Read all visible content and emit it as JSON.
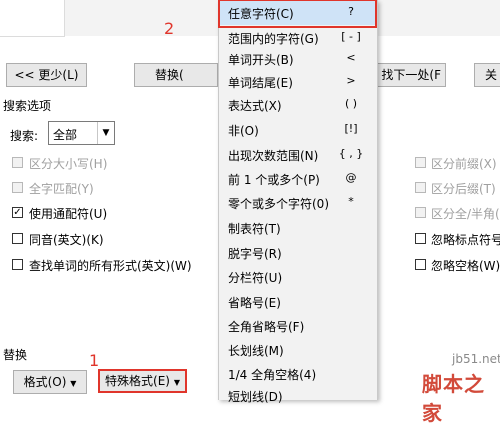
{
  "annotations": {
    "step1": "1",
    "step2": "2"
  },
  "buttons": {
    "less": "<< 更少(L)",
    "replace": "替换(",
    "find_next": "找下一处(F",
    "close": "关"
  },
  "search_options": {
    "title": "搜索选项",
    "search_label": "搜索:",
    "search_value": "全部",
    "left_options": [
      {
        "label": "区分大小写(H)",
        "checked": false,
        "disabled": true
      },
      {
        "label": "全字匹配(Y)",
        "checked": false,
        "disabled": true
      },
      {
        "label": "使用通配符(U)",
        "checked": true,
        "disabled": false
      },
      {
        "label": "同音(英文)(K)",
        "checked": false,
        "disabled": false
      },
      {
        "label": "查找单词的所有形式(英文)(W)",
        "checked": false,
        "disabled": false
      }
    ],
    "right_options": [
      {
        "label": "区分前缀(X)",
        "checked": false,
        "disabled": true
      },
      {
        "label": "区分后缀(T)",
        "checked": false,
        "disabled": true
      },
      {
        "label": "区分全/半角(",
        "checked": false,
        "disabled": true
      },
      {
        "label": "忽略标点符号",
        "checked": false,
        "disabled": false
      },
      {
        "label": "忽略空格(W)",
        "checked": false,
        "disabled": false
      }
    ]
  },
  "replace_section": {
    "title": "替换",
    "format_button": "格式(O)",
    "special_button": "特殊格式(E)"
  },
  "menu": {
    "items": [
      {
        "label": "任意字符(C)",
        "symbol": "?"
      },
      {
        "label": "范围内的字符(G)",
        "symbol": "[ - ]"
      },
      {
        "label": "单词开头(B)",
        "symbol": "<"
      },
      {
        "label": "单词结尾(E)",
        "symbol": ">"
      },
      {
        "label": "表达式(X)",
        "symbol": "( )"
      },
      {
        "label": "非(O)",
        "symbol": "[!]"
      },
      {
        "label": "出现次数范围(N)",
        "symbol": "{ , }"
      },
      {
        "label": "前 1 个或多个(P)",
        "symbol": "@"
      },
      {
        "label": "零个或多个字符(0)",
        "symbol": "*"
      },
      {
        "label": "制表符(T)",
        "symbol": ""
      },
      {
        "label": "脱字号(R)",
        "symbol": ""
      },
      {
        "label": "分栏符(U)",
        "symbol": ""
      },
      {
        "label": "省略号(E)",
        "symbol": ""
      },
      {
        "label": "全角省略号(F)",
        "symbol": ""
      },
      {
        "label": "长划线(M)",
        "symbol": ""
      },
      {
        "label": "1/4 全角空格(4)",
        "symbol": ""
      },
      {
        "label": "短划线(D)",
        "symbol": ""
      }
    ]
  },
  "watermark": {
    "site": "jb51.net",
    "brand": "脚本之家"
  },
  "colors": {
    "annotation_red": "#e0352b",
    "highlight": "#cfe3f7",
    "menu_bg": "#f2f2f2"
  }
}
